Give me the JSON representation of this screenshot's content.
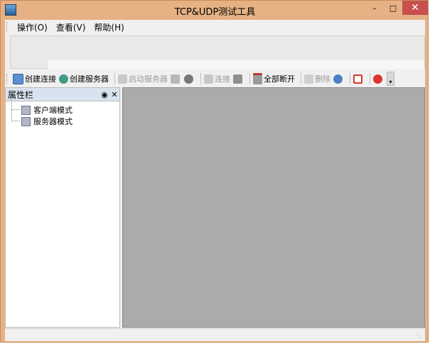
{
  "window": {
    "title": "TCP&UDP测试工具"
  },
  "menu": {
    "items": [
      {
        "label": "操作(O)"
      },
      {
        "label": "查看(V)"
      },
      {
        "label": "帮助(H)"
      }
    ]
  },
  "toolbar": {
    "create_connection": "创建连接",
    "create_server": "创建服务器",
    "start_server": "启动服务器",
    "connect": "连接",
    "disconnect_all": "全部断开",
    "delete": "删除"
  },
  "properties": {
    "title": "属性栏",
    "tree": [
      {
        "label": "客户端模式"
      },
      {
        "label": "服务器模式"
      }
    ]
  }
}
